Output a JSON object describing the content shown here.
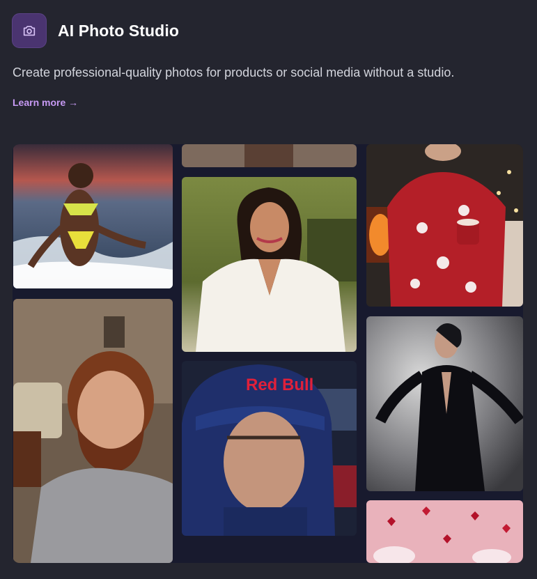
{
  "header": {
    "icon": "camera-icon",
    "title": "AI Photo Studio"
  },
  "description": "Create professional-quality photos for products or social media without a studio.",
  "learn_more": "Learn more →",
  "gallery": {
    "items": [
      {
        "name": "beach-swimsuit-photo"
      },
      {
        "name": "cropped-top-photo"
      },
      {
        "name": "christmas-sweater-photo"
      },
      {
        "name": "white-blouse-portrait-photo"
      },
      {
        "name": "bearded-man-selfie-photo"
      },
      {
        "name": "racing-driver-photo",
        "helmet_text": "Red Bull"
      },
      {
        "name": "black-suit-fashion-photo"
      },
      {
        "name": "valentine-hearts-photo"
      }
    ]
  },
  "colors": {
    "background": "#24252f",
    "accent": "#c79af4",
    "icon_bg": "#4a3470"
  }
}
